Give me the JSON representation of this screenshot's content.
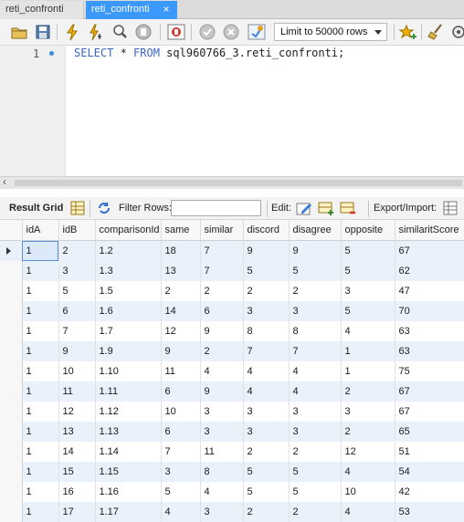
{
  "tabs": [
    {
      "label": "reti_confronti",
      "active": false
    },
    {
      "label": "reti_confronti",
      "active": true,
      "close_glyph": "×"
    }
  ],
  "toolbar": {
    "limit_select_value": "Limit to 50000 rows",
    "icons": [
      "open-folder-icon",
      "save-icon",
      "execute-lightning-icon",
      "execute-current-lightning-icon",
      "explain-magnifier-icon",
      "stop-icon",
      "toggle-error-stop-icon",
      "commit-icon",
      "rollback-icon",
      "autocommit-icon",
      "add-snippet-star-icon",
      "beautify-broom-icon"
    ]
  },
  "editor": {
    "line_number": "1",
    "code_keyword_select": "SELECT",
    "code_star": " * ",
    "code_keyword_from": "FROM",
    "code_rest": " sql960766_3.reti_confronti;"
  },
  "result_toolbar": {
    "result_grid_label": "Result Grid",
    "filter_rows_label": "Filter Rows:",
    "filter_value": "",
    "edit_label": "Edit:",
    "export_import_label": "Export/Import:"
  },
  "grid": {
    "columns": [
      "idA",
      "idB",
      "comparisonId",
      "same",
      "similar",
      "discord",
      "disagree",
      "opposite",
      "similaritScore"
    ],
    "rows": [
      [
        "1",
        "2",
        "1.2",
        "18",
        "7",
        "9",
        "9",
        "5",
        "67"
      ],
      [
        "1",
        "3",
        "1.3",
        "13",
        "7",
        "5",
        "5",
        "5",
        "62"
      ],
      [
        "1",
        "5",
        "1.5",
        "2",
        "2",
        "2",
        "2",
        "3",
        "47"
      ],
      [
        "1",
        "6",
        "1.6",
        "14",
        "6",
        "3",
        "3",
        "5",
        "70"
      ],
      [
        "1",
        "7",
        "1.7",
        "12",
        "9",
        "8",
        "8",
        "4",
        "63"
      ],
      [
        "1",
        "9",
        "1.9",
        "9",
        "2",
        "7",
        "7",
        "1",
        "63"
      ],
      [
        "1",
        "10",
        "1.10",
        "11",
        "4",
        "4",
        "4",
        "1",
        "75"
      ],
      [
        "1",
        "11",
        "1.11",
        "6",
        "9",
        "4",
        "4",
        "2",
        "67"
      ],
      [
        "1",
        "12",
        "1.12",
        "10",
        "3",
        "3",
        "3",
        "3",
        "67"
      ],
      [
        "1",
        "13",
        "1.13",
        "6",
        "3",
        "3",
        "3",
        "2",
        "65"
      ],
      [
        "1",
        "14",
        "1.14",
        "7",
        "11",
        "2",
        "2",
        "12",
        "51"
      ],
      [
        "1",
        "15",
        "1.15",
        "3",
        "8",
        "5",
        "5",
        "4",
        "54"
      ],
      [
        "1",
        "16",
        "1.16",
        "5",
        "4",
        "5",
        "5",
        "10",
        "42"
      ],
      [
        "1",
        "17",
        "1.17",
        "4",
        "3",
        "2",
        "2",
        "4",
        "53"
      ]
    ]
  },
  "colors": {
    "active_tab": "#3b99fc",
    "keyword": "#3b64c8",
    "row_alt": "#e9f1fb"
  }
}
